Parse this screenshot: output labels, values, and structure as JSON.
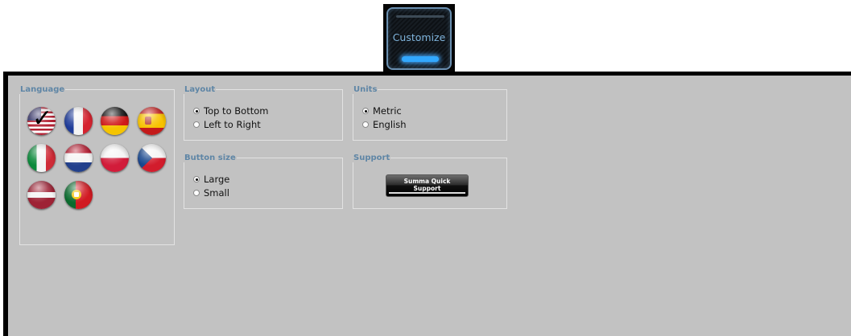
{
  "customize": {
    "label": "Customize"
  },
  "language": {
    "legend": "Language",
    "flags": [
      {
        "name": "flag-usa-icon",
        "selected": true
      },
      {
        "name": "flag-france-icon"
      },
      {
        "name": "flag-germany-icon"
      },
      {
        "name": "flag-spain-icon"
      },
      {
        "name": "flag-italy-icon"
      },
      {
        "name": "flag-netherlands-icon"
      },
      {
        "name": "flag-poland-icon"
      },
      {
        "name": "flag-czech-icon"
      },
      {
        "name": "flag-latvia-icon"
      },
      {
        "name": "flag-portugal-icon"
      }
    ]
  },
  "layout": {
    "legend": "Layout",
    "options": [
      {
        "label": "Top to Bottom",
        "selected": true
      },
      {
        "label": "Left to Right",
        "selected": false
      }
    ]
  },
  "units": {
    "legend": "Units",
    "options": [
      {
        "label": "Metric",
        "selected": true
      },
      {
        "label": "English",
        "selected": false
      }
    ]
  },
  "button_size": {
    "legend": "Button size",
    "options": [
      {
        "label": "Large",
        "selected": true
      },
      {
        "label": "Small",
        "selected": false
      }
    ]
  },
  "support": {
    "legend": "Support",
    "button_line1": "Summa Quick",
    "button_line2": "Support"
  },
  "colors": {
    "legend": "#5f86a6",
    "panel": "#c2c2c2",
    "glow": "#32a8ff"
  }
}
